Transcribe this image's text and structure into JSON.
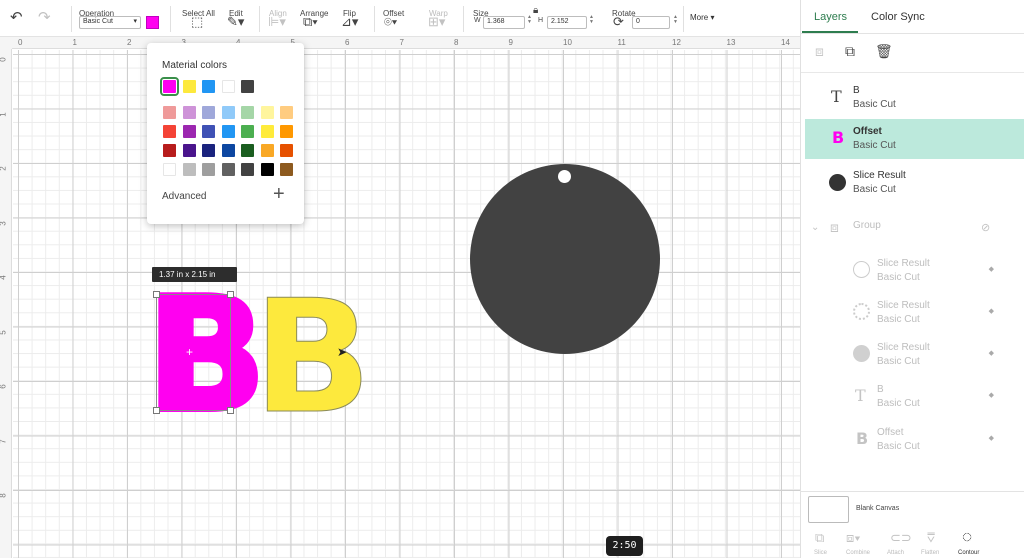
{
  "toolbar": {
    "operation_label": "Operation",
    "operation_value": "Basic Cut",
    "operation_color": "#ff00f0",
    "select_all_label": "Select All",
    "edit_label": "Edit",
    "align_label": "Align",
    "arrange_label": "Arrange",
    "flip_label": "Flip",
    "offset_label": "Offset",
    "warp_label": "Warp",
    "size_label": "Size",
    "w_label": "W",
    "w_value": "1.368",
    "h_label": "H",
    "h_value": "2.152",
    "rotate_label": "Rotate",
    "rotate_value": "0",
    "more_label": "More"
  },
  "ruler": {
    "top": [
      "0",
      "1",
      "2",
      "3",
      "4",
      "5",
      "6",
      "7",
      "8",
      "9",
      "10",
      "11",
      "12",
      "13",
      "14"
    ],
    "left": [
      "0",
      "1",
      "2",
      "3",
      "4",
      "5",
      "6",
      "7",
      "8"
    ]
  },
  "color_popup": {
    "title": "Material colors",
    "advanced_label": "Advanced",
    "material_row": [
      "#ff00f0",
      "#fde93d",
      "#2196f3",
      "#ffffff",
      "#424242"
    ],
    "palette": [
      [
        "#ef9a9a",
        "#ce93d8",
        "#9fa8da",
        "#90caf9",
        "#a5d6a7",
        "#fff59d",
        "#ffcc80"
      ],
      [
        "#f44336",
        "#9c27b0",
        "#3f51b5",
        "#2196f3",
        "#4caf50",
        "#ffeb3b",
        "#ff9800"
      ],
      [
        "#b71c1c",
        "#4a148c",
        "#1a237e",
        "#0d47a1",
        "#1b5e20",
        "#f9a825",
        "#e65100"
      ],
      [
        "#ffffff",
        "#bdbdbd",
        "#9e9e9e",
        "#616161",
        "#424242",
        "#000000",
        "#8d5a1f"
      ]
    ]
  },
  "canvas": {
    "dimension_tooltip": "1.37  in x 2.15  in",
    "letter_magenta": "B",
    "letter_yellow": "B",
    "magenta_color": "#ff00f0",
    "yellow_color": "#fde93d",
    "circle_color": "#424242"
  },
  "video": {
    "time": "2:50"
  },
  "panel": {
    "tabs": [
      "Layers",
      "Color Sync"
    ],
    "layers": [
      {
        "name": "B",
        "sub": "Basic Cut",
        "icon": "text-icon"
      },
      {
        "name": "Offset",
        "sub": "Basic Cut",
        "icon": "offset-shape-icon"
      },
      {
        "name": "Slice Result",
        "sub": "Basic Cut",
        "icon": "circle-icon"
      },
      {
        "name": "Group",
        "icon": "group-icon"
      },
      {
        "name": "Slice Result",
        "sub": "Basic Cut",
        "icon": "circle-outline-icon"
      },
      {
        "name": "Slice Result",
        "sub": "Basic Cut",
        "icon": "circle-outline-icon"
      },
      {
        "name": "Slice Result",
        "sub": "Basic Cut",
        "icon": "circle-filled-icon"
      },
      {
        "name": "B",
        "sub": "Basic Cut",
        "icon": "text-icon"
      },
      {
        "name": "Offset",
        "sub": "Basic Cut",
        "icon": "offset-shape-icon"
      }
    ],
    "blank_canvas_label": "Blank Canvas",
    "bottom_tools": [
      "Slice",
      "Combine",
      "Attach",
      "Flatten",
      "Contour"
    ]
  }
}
